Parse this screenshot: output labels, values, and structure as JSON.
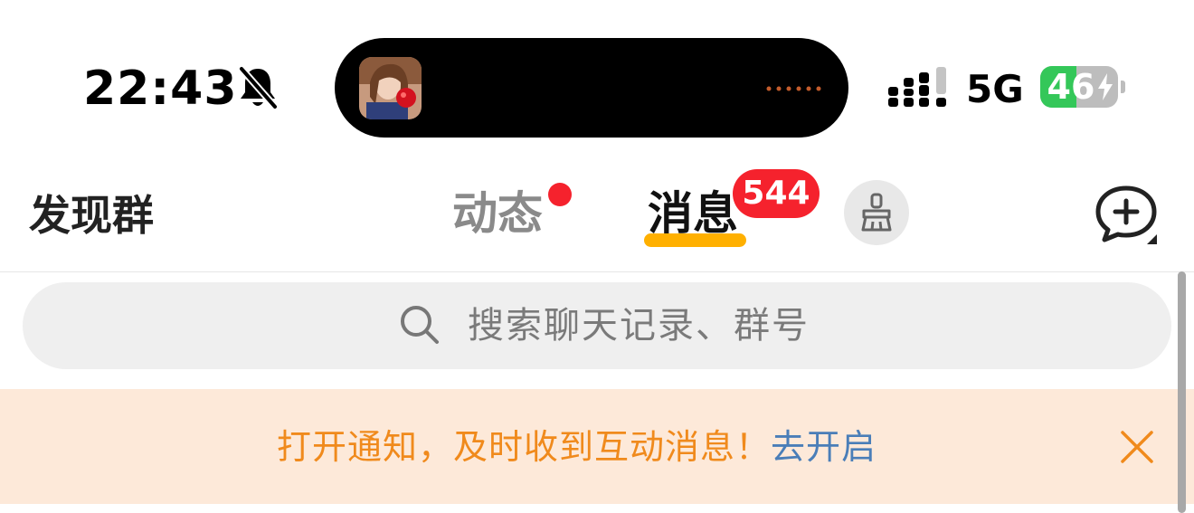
{
  "status_bar": {
    "time": "22:43",
    "network": "5G",
    "battery": {
      "percent": 46,
      "percent_label": "46",
      "charging": true
    },
    "icons": [
      "bell-slash-icon",
      "signal-icon",
      "bolt-icon"
    ]
  },
  "dynamic_island": {
    "icons": [
      "album-art-thumbnail",
      "audio-waveform-icon"
    ]
  },
  "header": {
    "discover_label": "发现群",
    "tabs": [
      {
        "label": "动态",
        "active": false,
        "has_dot": true
      },
      {
        "label": "消息",
        "active": true,
        "badge": "544"
      }
    ],
    "icons": [
      "broom-icon",
      "add-chat-icon"
    ]
  },
  "search": {
    "placeholder": "搜索聊天记录、群号",
    "icon": "search-icon"
  },
  "notice": {
    "message": "打开通知，及时收到互动消息！",
    "action": "去开启",
    "icon": "close-icon"
  },
  "colors": {
    "badge": "#f5222d",
    "tab_underline": "#ffb000",
    "notice_bg": "#fde9d9",
    "notice_text": "#f08a1c",
    "notice_link": "#4a7eb8",
    "battery_fill": "#34c759"
  }
}
